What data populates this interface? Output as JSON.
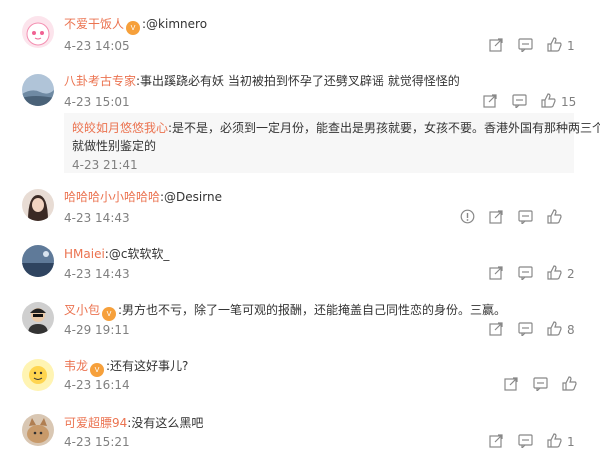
{
  "comments": [
    {
      "user": "不爱干饭人",
      "badge": true,
      "text": ":@kimnero",
      "time": "4-23 14:05",
      "likes": "1"
    },
    {
      "user": "八卦考古专家",
      "badge": false,
      "text": ":事出蹊跷必有妖 当初被拍到怀孕了还劈叉辟谣 就觉得怪怪的",
      "time": "4-23 15:01",
      "likes": "15",
      "reply": {
        "user": "皎皎如月悠悠我心",
        "text": ":是不是，必须到一定月份，能查出是男孩就要，女孩不要。香港外国有那种两三个月",
        "text2": "就做性别鉴定的",
        "time": "4-23 21:41"
      }
    },
    {
      "user": "哈哈哈小小哈哈哈",
      "badge": false,
      "text": ":@Desirne",
      "time": "4-23 14:43",
      "likes": ""
    },
    {
      "user": "HMaiei",
      "badge": false,
      "text": ":@c软软软_",
      "time": "4-23 14:43",
      "likes": "2"
    },
    {
      "user": "叉小包",
      "badge": true,
      "text": ":男方也不亏，除了一笔可观的报酬，还能掩盖自己同性恋的身份。三赢。",
      "time": "4-29 19:11",
      "likes": "8"
    },
    {
      "user": "韦龙",
      "badge": true,
      "text": ":还有这好事儿?",
      "time": "4-23 16:14",
      "likes": ""
    },
    {
      "user": "可爱超膘94",
      "badge": false,
      "text": ":没有这么黑吧",
      "time": "4-23 15:21",
      "likes": "1"
    }
  ],
  "icons": {
    "share": "share-icon",
    "comment": "comment-icon",
    "like": "like-icon",
    "report": "report-icon"
  },
  "colors": {
    "username": "#eb7350",
    "meta": "#808080",
    "text": "#333333",
    "reply_bg": "#f7f7f7"
  }
}
